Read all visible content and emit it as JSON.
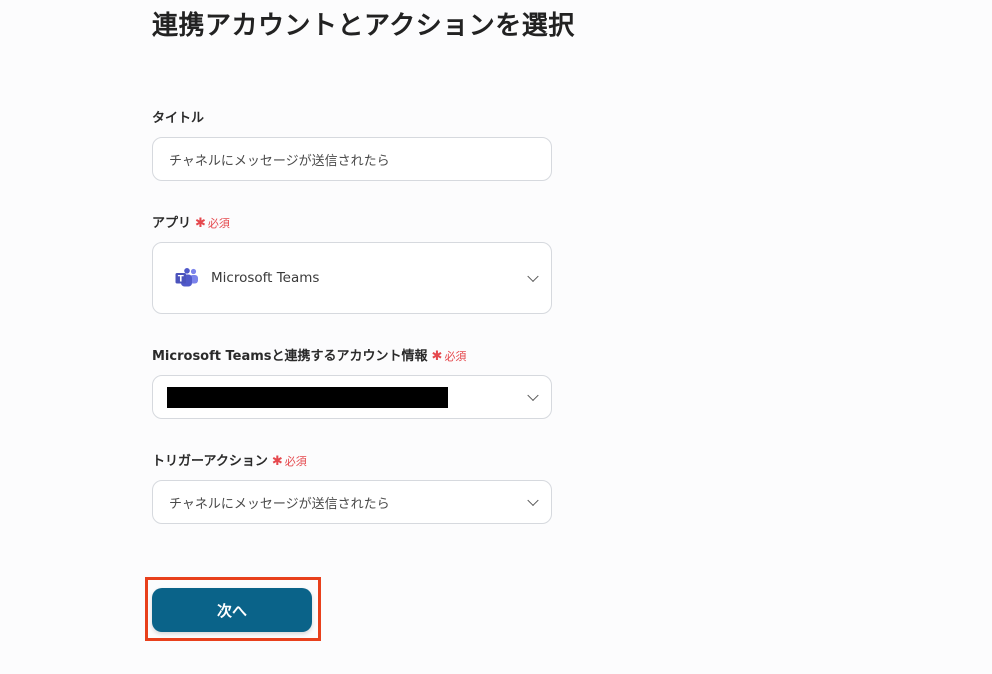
{
  "page": {
    "title": "連携アカウントとアクションを選択"
  },
  "form": {
    "required_text": "必須",
    "required_mark": "✱",
    "title_field": {
      "label": "タイトル",
      "value": "チャネルにメッセージが送信されたら"
    },
    "app_field": {
      "label": "アプリ",
      "value": "Microsoft Teams",
      "icon": "microsoft-teams-icon"
    },
    "account_field": {
      "label": "Microsoft Teamsと連携するアカウント情報"
    },
    "trigger_field": {
      "label": "トリガーアクション",
      "value": "チャネルにメッセージが送信されたら"
    }
  },
  "actions": {
    "next_label": "次へ"
  },
  "colors": {
    "primary_button": "#0a6389",
    "highlight_border": "#e8401c",
    "required": "#e5484d",
    "teams_purple": "#5059c9"
  }
}
